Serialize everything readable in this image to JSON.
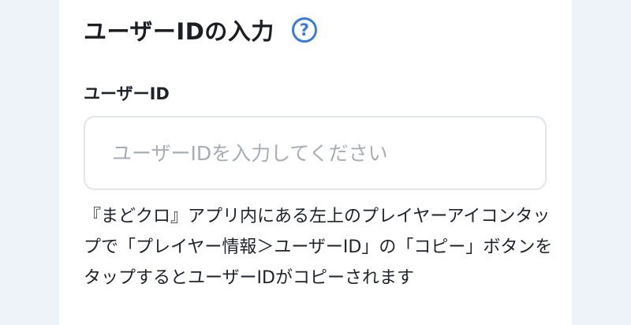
{
  "page": {
    "title": "ユーザーIDの入力",
    "help_glyph": "?",
    "field_label": "ユーザーID",
    "input_value": "",
    "input_placeholder": "ユーザーIDを入力してください",
    "help_text": "『まどクロ』アプリ内にある左上のプレイヤーアイコンタップで「プレイヤー情報＞ユーザーID」の「コピー」ボタンをタップするとユーザーIDがコピーされます"
  },
  "colors": {
    "background": "#eef3fa",
    "card": "#ffffff",
    "accent": "#3b7bd4",
    "input_border": "#e2e5ea",
    "placeholder": "#a8adb3"
  },
  "icons": {
    "help": "question-circle-icon"
  }
}
